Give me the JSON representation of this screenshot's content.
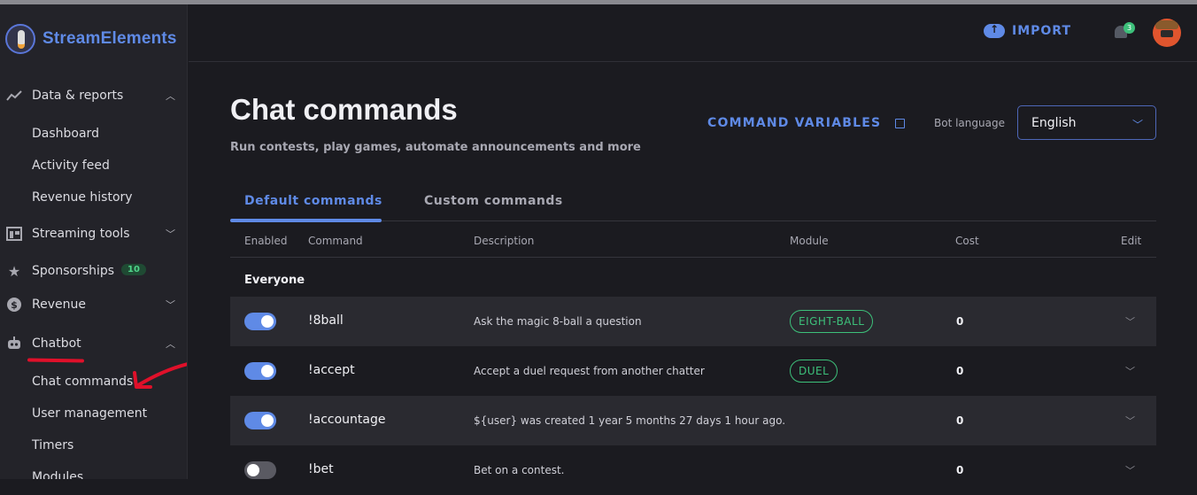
{
  "app": {
    "brand": "StreamElements",
    "accent": "#5f8ae6",
    "annotation_color": "#e0102a"
  },
  "sidebar": {
    "sections": [
      {
        "label": "Data & reports",
        "icon": "trend-icon",
        "expanded": true
      },
      {
        "label": "Streaming tools",
        "icon": "layout-icon",
        "expanded": false
      },
      {
        "label": "Sponsorships",
        "icon": "star-icon",
        "badge": "10"
      },
      {
        "label": "Revenue",
        "icon": "dollar-icon",
        "expanded": false
      },
      {
        "label": "Chatbot",
        "icon": "robot-icon",
        "expanded": true
      }
    ],
    "data_items": [
      "Dashboard",
      "Activity feed",
      "Revenue history"
    ],
    "chatbot_items": [
      "Chat commands",
      "User management",
      "Timers",
      "Modules"
    ]
  },
  "topbar": {
    "import_label": "IMPORT",
    "notification_count": "3"
  },
  "page": {
    "title": "Chat commands",
    "subtitle": "Run contests, play games, automate announcements and more",
    "command_variables": "COMMAND VARIABLES",
    "bot_language_label": "Bot language",
    "bot_language_value": "English"
  },
  "tabs": [
    "Default commands",
    "Custom commands"
  ],
  "table": {
    "headers": [
      "Enabled",
      "Command",
      "Description",
      "Module",
      "Cost",
      "Edit"
    ],
    "group": "Everyone",
    "rows": [
      {
        "enabled": true,
        "command": "!8ball",
        "description": "Ask the magic 8-ball a question",
        "module": "EIGHT-BALL",
        "cost": "0"
      },
      {
        "enabled": true,
        "command": "!accept",
        "description": "Accept a duel request from another chatter",
        "module": "DUEL",
        "cost": "0"
      },
      {
        "enabled": true,
        "command": "!accountage",
        "description": "${user} was created 1 year 5 months 27 days 1 hour ago.",
        "module": "",
        "cost": "0"
      },
      {
        "enabled": false,
        "command": "!bet",
        "description": "Bet on a contest.",
        "module": "",
        "cost": "0"
      }
    ]
  }
}
